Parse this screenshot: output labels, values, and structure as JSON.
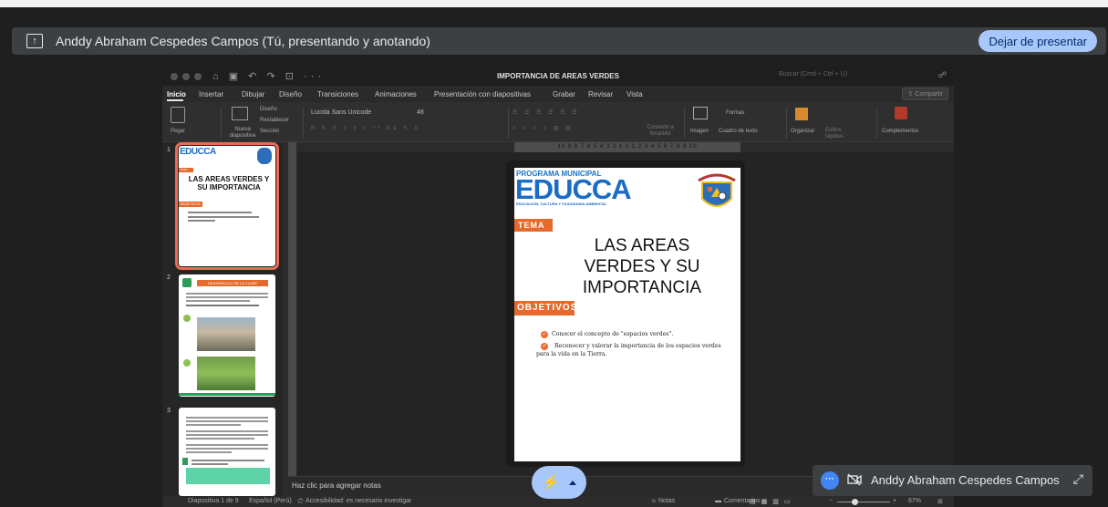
{
  "presenting_bar": {
    "presenter_label": "Anddy Abraham Cespedes Campos (Tú, presentando y anotando)",
    "stop_button": "Dejar de presentar"
  },
  "ppt": {
    "doc_title": "IMPORTANCIA DE AREAS VERDES",
    "search_placeholder": "Buscar (Cmd + Ctrl + U)",
    "tabs": [
      "Inicio",
      "Insertar",
      "Dibujar",
      "Diseño",
      "Transiciones",
      "Animaciones",
      "Presentación con diapositivas",
      "Grabar",
      "Revisar",
      "Vista"
    ],
    "share_label": "Compartir",
    "ribbon": {
      "paste": "Pegar",
      "new_slide": "Nueva diapositiva",
      "layout": "Diseño",
      "reset": "Restablecer",
      "section": "Sección",
      "font_name": "Lucida Sans Unicode",
      "font_size": "48",
      "convert_smartart": "Convertir a SmartArt",
      "image": "Imagen",
      "shapes": "Formas",
      "textbox": "Cuadro de texto",
      "arrange": "Organizar",
      "quick_styles": "Estilos rápidos",
      "addins": "Complementos"
    },
    "ruler_marks": "10 9 8 7 6 5 4 3 2 1 0 1 2 3 4 5 6 7 8 9 10",
    "thumbnails": [
      {
        "num": "1",
        "title": "LAS AREAS VERDES Y SU IMPORTANCIA",
        "tag": "TEMA",
        "objectives_tag": "OBJETIVOS"
      },
      {
        "num": "2",
        "banner": "DESARROLLO DE LA CLASE"
      },
      {
        "num": "3"
      }
    ],
    "slide": {
      "program": "PROGRAMA MUNICIPAL",
      "brand": "EDUCCA",
      "brand_sub": "EDUCACIÓN, CULTURA Y CIUDADANÍA AMBIENTAL",
      "tema": "TEMA",
      "title_lines": [
        "LAS AREAS",
        "VERDES Y SU",
        "IMPORTANCIA"
      ],
      "objetivos": "OBJETIVOS",
      "objective_1": "Conocer el concepto de \"espacios verdes\".",
      "objective_2a": "Reconocer y valorar la importancia de los espacios verdes",
      "objective_2b": "para la vida en la Tierra."
    },
    "notes_placeholder": "Haz clic para agregar notas",
    "status": {
      "slide_of": "Diapositiva 1 de 9",
      "language": "Español (Perú)",
      "accessibility": "Accesibilidad: es necesario investigar",
      "notes": "Notas",
      "comments": "Comentarios",
      "zoom": "67%"
    }
  },
  "speaker_tile": {
    "name": "Anddy Abraham Cespedes Campos"
  },
  "colors": {
    "accent_blue": "#a8c7fa",
    "slide_orange": "#e66a2c",
    "educca_blue": "#1a6cc4"
  }
}
